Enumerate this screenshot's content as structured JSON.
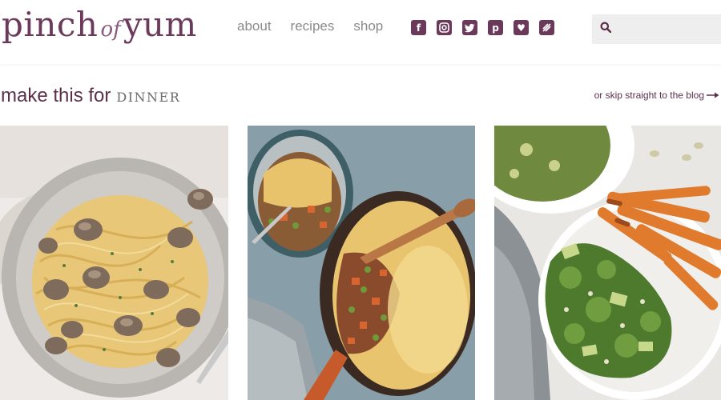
{
  "brand": {
    "logo_word1": "pinch",
    "logo_word2": "of",
    "logo_word3": "yum",
    "accent": "#6b3a5b"
  },
  "nav": {
    "items": [
      {
        "label": "about"
      },
      {
        "label": "recipes"
      },
      {
        "label": "shop"
      }
    ]
  },
  "social": [
    {
      "icon": "facebook-icon",
      "glyph": "f"
    },
    {
      "icon": "instagram-icon",
      "glyph": ""
    },
    {
      "icon": "twitter-icon",
      "glyph": ""
    },
    {
      "icon": "pinterest-icon",
      "glyph": "p"
    },
    {
      "icon": "heart-icon",
      "glyph": "♥"
    },
    {
      "icon": "newsletter-icon",
      "glyph": ""
    }
  ],
  "search": {
    "icon": "search-icon",
    "value": "",
    "placeholder": ""
  },
  "heading": {
    "lead": "make this for",
    "category": "DINNER"
  },
  "skip_link": {
    "label": "or skip straight to the blog",
    "icon": "arrow-right-icon"
  },
  "cards": [
    {
      "image": "creamy-mushroom-pasta"
    },
    {
      "image": "shepherds-pie-skillet"
    },
    {
      "image": "kale-salad-sweet-potato-fries"
    }
  ]
}
